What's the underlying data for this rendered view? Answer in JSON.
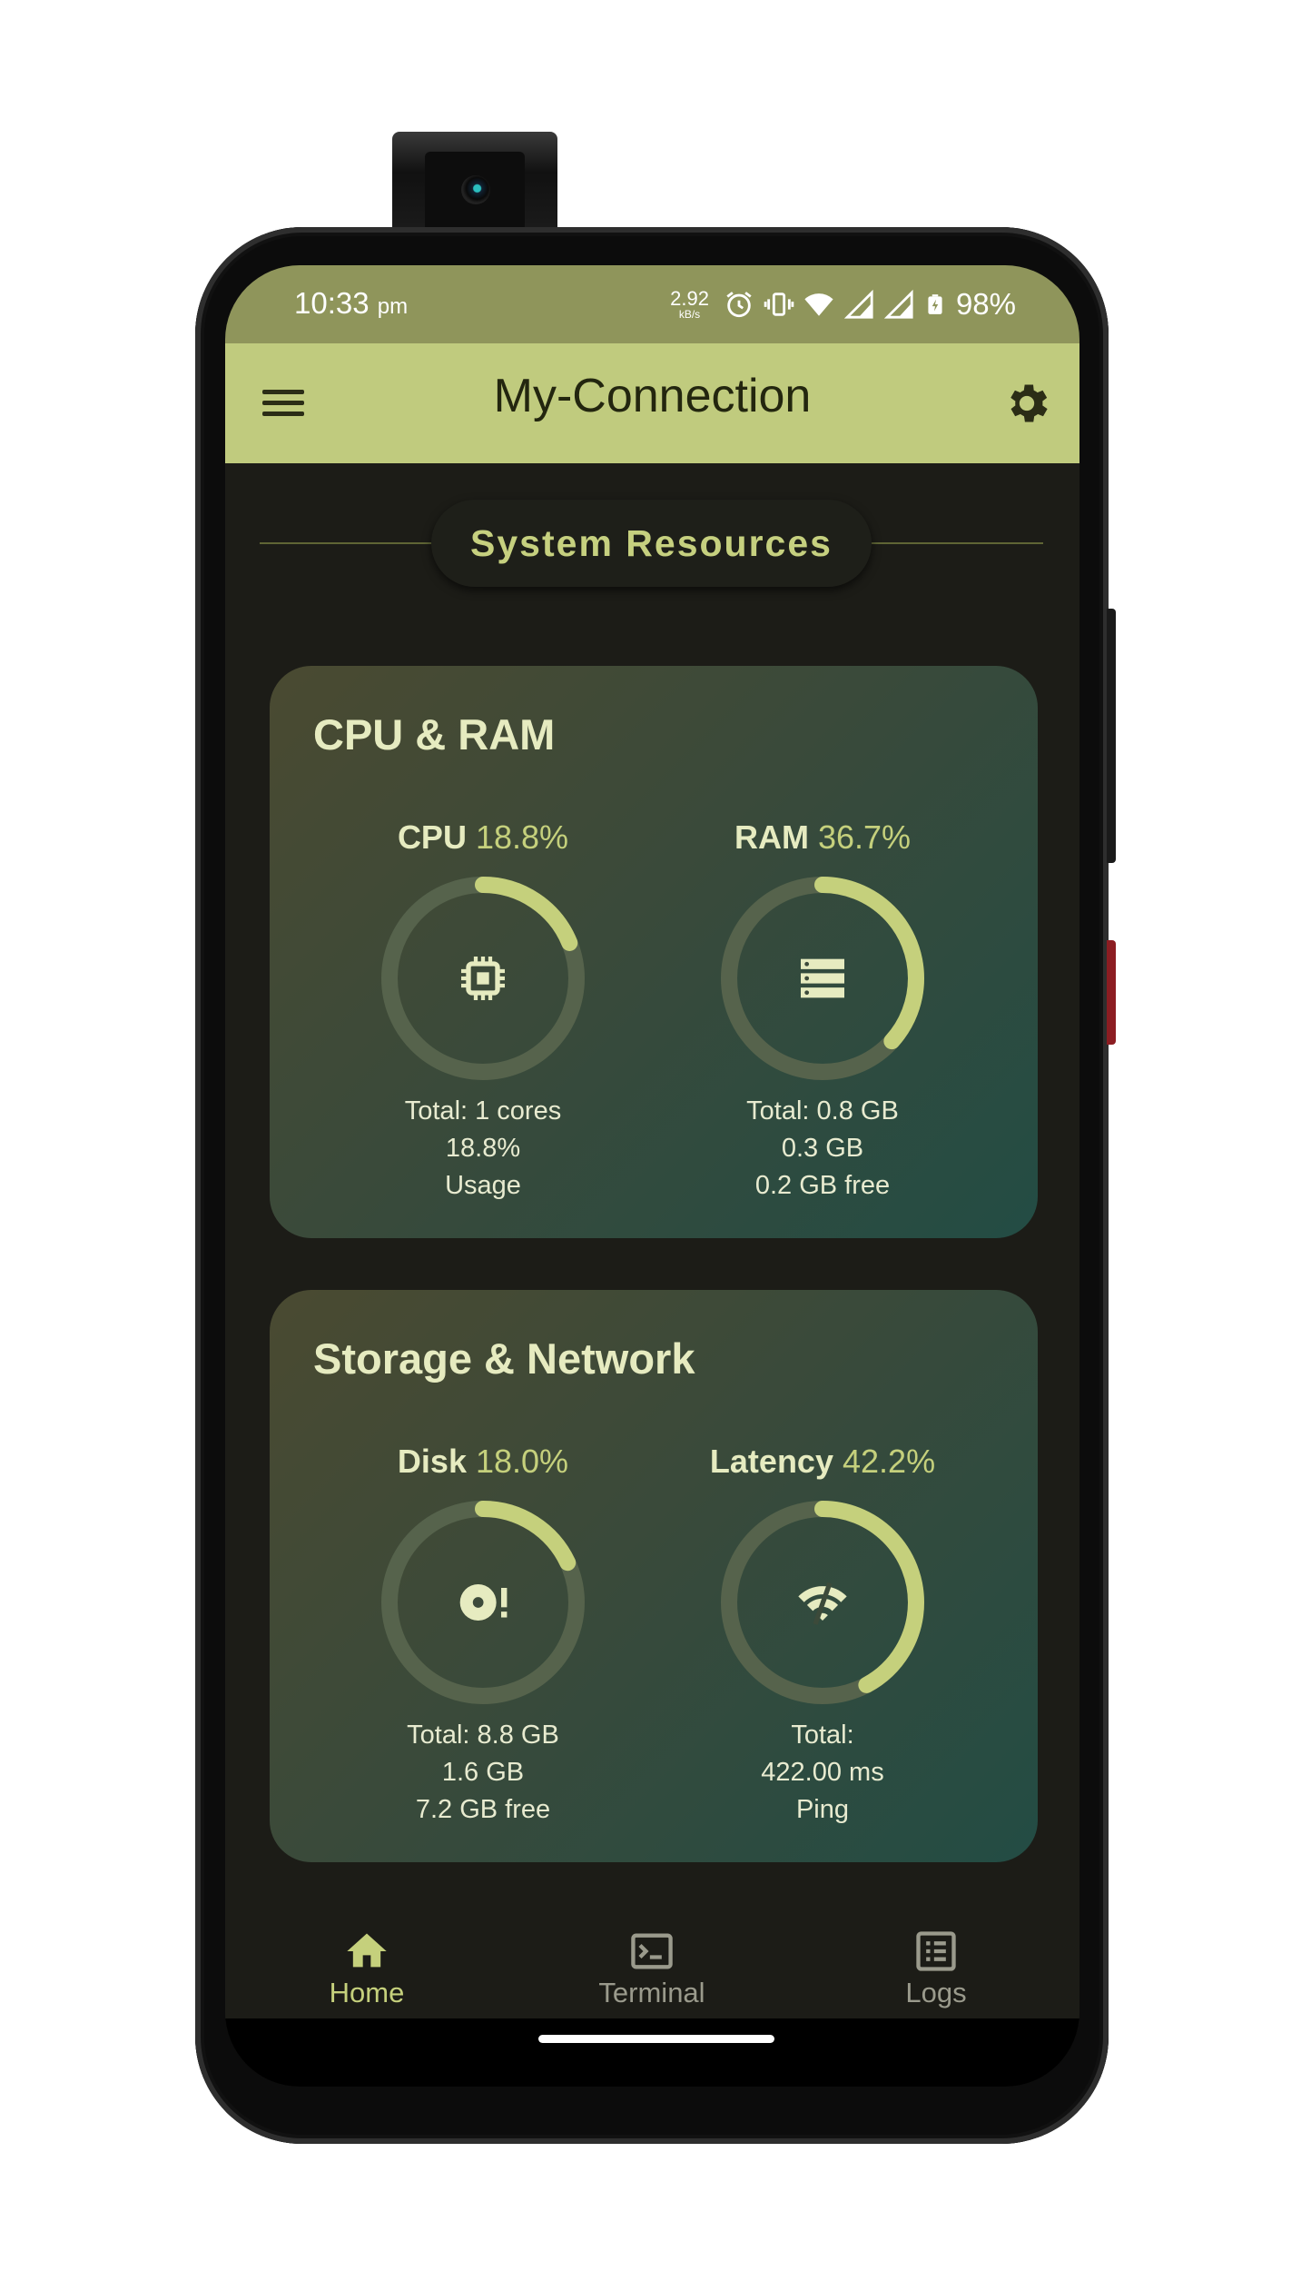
{
  "status_bar": {
    "time": "10:33",
    "ampm": "pm",
    "net_speed": "2.92",
    "net_unit": "kB/s",
    "battery": "98%",
    "icons": [
      "alarm-icon",
      "vibrate-icon",
      "wifi-icon",
      "signal-icon",
      "signal-icon",
      "battery-icon"
    ]
  },
  "app_bar": {
    "title": "My-Connection",
    "menu_icon": "hamburger-menu-icon",
    "settings_icon": "gear-icon"
  },
  "section": {
    "title": "System Resources"
  },
  "cards": [
    {
      "title": "CPU & RAM",
      "metrics": [
        {
          "label": "CPU",
          "percent": "18.8%",
          "fraction": 0.188,
          "icon": "chip-icon",
          "lines": [
            "Total: 1 cores",
            "18.8%",
            "Usage"
          ]
        },
        {
          "label": "RAM",
          "percent": "36.7%",
          "fraction": 0.367,
          "icon": "memory-stack-icon",
          "lines": [
            "Total: 0.8 GB",
            "0.3 GB",
            "0.2 GB free"
          ]
        }
      ]
    },
    {
      "title": "Storage & Network",
      "metrics": [
        {
          "label": "Disk",
          "percent": "18.0%",
          "fraction": 0.18,
          "icon": "disk-alert-icon",
          "lines": [
            "Total: 8.8 GB",
            "1.6 GB",
            "7.2 GB free"
          ]
        },
        {
          "label": "Latency",
          "percent": "42.2%",
          "fraction": 0.422,
          "icon": "wifi-off-icon",
          "lines": [
            "Total:",
            "422.00 ms",
            "Ping"
          ]
        }
      ]
    }
  ],
  "bottom_nav": [
    {
      "label": "Home",
      "icon": "home-icon",
      "active": true
    },
    {
      "label": "Terminal",
      "icon": "terminal-icon",
      "active": false
    },
    {
      "label": "Logs",
      "icon": "list-icon",
      "active": false
    }
  ],
  "colors": {
    "app_bar": "#c0cb7e",
    "status_bar": "#8f955b",
    "accent": "#c5d07c",
    "track": "#56634c",
    "background": "#1c1c17",
    "nav_active": "#c5d07c",
    "nav_inactive": "#9a9a8c"
  }
}
